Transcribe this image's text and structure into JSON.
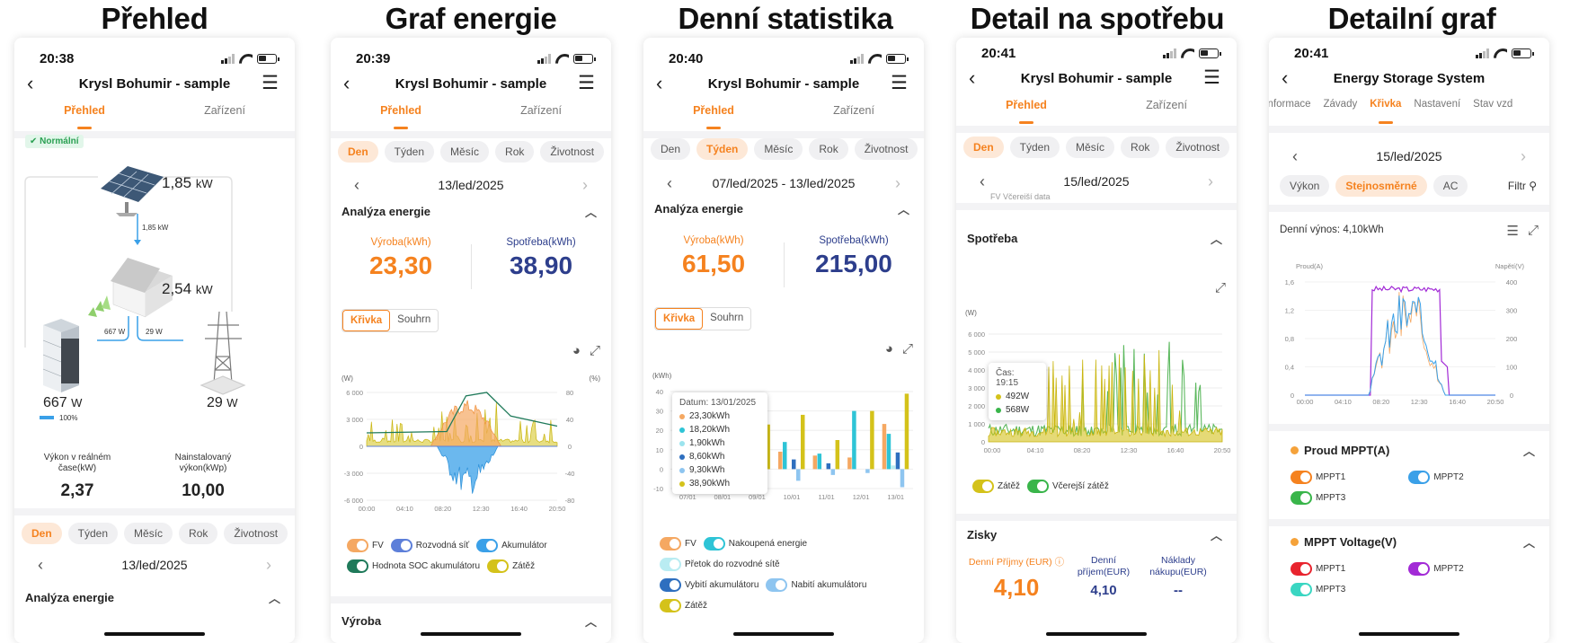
{
  "columns": [
    "Přehled",
    "Graf energie",
    "Denní statistika",
    "Detail na spotřebu",
    "Detailní graf"
  ],
  "colors": {
    "accent": "#f5821f",
    "navy": "#2d3e8c",
    "solar_blue": "#3aa0e8",
    "olive": "#d4c21a",
    "green": "#39b54a"
  },
  "p1": {
    "time": "20:38",
    "title": "Krysl Bohumir - sample",
    "tabs": [
      "Přehled",
      "Zařízení"
    ],
    "badge": "Normální",
    "pv_power": "1,85",
    "pv_unit": "kW",
    "pv_flow": "1,85 kW",
    "home_power": "2,54",
    "home_unit": "kW",
    "flow_left": "667 W",
    "flow_right": "29 W",
    "battery_power": "667",
    "battery_unit": "W",
    "battery_soc": "100%",
    "grid_power": "29",
    "grid_unit": "W",
    "realtime_label": "Výkon v reálném čase(kW)",
    "realtime_value": "2,37",
    "installed_label": "Nainstalovaný výkon(kWp)",
    "installed_value": "10,00",
    "periods": [
      "Den",
      "Týden",
      "Měsíc",
      "Rok",
      "Životnost"
    ],
    "date": "13/led/2025",
    "section": "Analýza energie"
  },
  "p2": {
    "time": "20:39",
    "title": "Krysl Bohumir - sample",
    "tabs": [
      "Přehled",
      "Zařízení"
    ],
    "periods": [
      "Den",
      "Týden",
      "Měsíc",
      "Rok",
      "Životnost"
    ],
    "date": "13/led/2025",
    "section": "Analýza energie",
    "prod_label": "Výroba(kWh)",
    "prod_value": "23,30",
    "cons_label": "Spotřeba(kWh)",
    "cons_value": "38,90",
    "seg": [
      "Křivka",
      "Souhrn"
    ],
    "y_left_unit": "(W)",
    "y_right_unit": "(%)",
    "legend": [
      "FV",
      "Rozvodná síť",
      "Akumulátor",
      "Hodnota SOC akumulátoru",
      "Zátěž"
    ],
    "section2": "Výroba"
  },
  "p3": {
    "time": "20:40",
    "title": "Krysl Bohumir - sample",
    "tabs": [
      "Přehled",
      "Zařízení"
    ],
    "periods": [
      "Den",
      "Týden",
      "Měsíc",
      "Rok",
      "Životnost"
    ],
    "date": "07/led/2025 - 13/led/2025",
    "section": "Analýza energie",
    "prod_label": "Výroba(kWh)",
    "prod_value": "61,50",
    "cons_label": "Spotřeba(kWh)",
    "cons_value": "215,00",
    "seg": [
      "Křivka",
      "Souhrn"
    ],
    "y_unit": "(kWh)",
    "tooltip_title": "Datum: 13/01/2025",
    "tooltip_rows": [
      "23,30kWh",
      "18,20kWh",
      "1,90kWh",
      "8,60kWh",
      "9,30kWh",
      "38,90kWh"
    ],
    "legend": [
      "FV",
      "Nakoupená energie",
      "Přetok do rozvodné sítě",
      "Vybití akumulátoru",
      "Nabití akumulátoru",
      "Zátěž"
    ]
  },
  "p4": {
    "time": "20:41",
    "title": "Krysl Bohumir - sample",
    "tabs": [
      "Přehled",
      "Zařízení"
    ],
    "periods": [
      "Den",
      "Týden",
      "Měsíc",
      "Rok",
      "Životnost"
    ],
    "date": "15/led/2025",
    "partial_legend": "FV   Včerejší data",
    "section": "Spotřeba",
    "y_unit": "(W)",
    "tooltip_title": "Čas: 19:15",
    "tooltip_rows": [
      "492W",
      "568W"
    ],
    "legend": [
      "Zátěž",
      "Včerejší zátěž"
    ],
    "section2": "Zisky",
    "daily_label": "Denní Příjmy (EUR)",
    "daily_value": "4,10",
    "income_label": "Denní příjem(EUR)",
    "income_value": "4,10",
    "cost_label": "Náklady nákupu(EUR)",
    "cost_value": "--"
  },
  "p5": {
    "time": "20:41",
    "title": "Energy Storage System",
    "tabs": [
      "informace",
      "Závady",
      "Křivka",
      "Nastavení",
      "Stav vzd"
    ],
    "date": "15/led/2025",
    "sub_tabs": [
      "Výkon",
      "Stejnosměrné",
      "AC"
    ],
    "filter": "Filtr",
    "daily_yield": "Denní výnos: 4,10kWh",
    "y_left_unit": "Proud(A)",
    "y_right_unit": "Napětí(V)",
    "group1": "Proud MPPT(A)",
    "group1_items": [
      "MPPT1",
      "MPPT2",
      "MPPT3"
    ],
    "group2": "MPPT Voltage(V)",
    "group2_items": [
      "MPPT1",
      "MPPT2",
      "MPPT3"
    ]
  },
  "chart_data": [
    {
      "type": "line",
      "title": "",
      "x": [
        "00:00",
        "04:10",
        "08:20",
        "12:30",
        "16:40",
        "20:50"
      ],
      "ylim": [
        -6000,
        6000
      ],
      "y2lim": [
        -80,
        80
      ],
      "series": [
        {
          "name": "FV",
          "values": [
            0,
            0,
            3200,
            5200,
            2500,
            0
          ]
        },
        {
          "name": "Rozvodná síť",
          "values": [
            0,
            0,
            0,
            0,
            0,
            0
          ]
        },
        {
          "name": "Akumulátor",
          "values": [
            0,
            0,
            -2000,
            -5500,
            1200,
            0
          ]
        },
        {
          "name": "Hodnota SOC akumulátoru",
          "values": [
            20,
            20,
            30,
            80,
            40,
            25
          ]
        },
        {
          "name": "Zátěž",
          "values": [
            2000,
            1800,
            2600,
            3000,
            3500,
            2400
          ]
        }
      ]
    },
    {
      "type": "bar",
      "categories": [
        "07/01",
        "08/01",
        "09/01",
        "10/01",
        "11/01",
        "12/01",
        "13/01"
      ],
      "ylim": [
        -10,
        40
      ],
      "series": [
        {
          "name": "FV",
          "values": [
            5,
            2,
            3,
            9,
            7,
            6,
            23.3
          ]
        },
        {
          "name": "Nakoupená energie",
          "values": [
            17,
            22,
            20,
            14,
            8,
            30,
            18.2
          ]
        },
        {
          "name": "Přetok do rozvodné sítě",
          "values": [
            0,
            0,
            0,
            0,
            0,
            0,
            1.9
          ]
        },
        {
          "name": "Vybití akumulátoru",
          "values": [
            0,
            0,
            0,
            5,
            3,
            0,
            8.6
          ]
        },
        {
          "name": "Nabití akumulátoru",
          "values": [
            -5,
            -3,
            -4,
            -6,
            -3,
            -2,
            -9.3
          ]
        },
        {
          "name": "Zátěž",
          "values": [
            22,
            24,
            23,
            28,
            15,
            30,
            38.9
          ]
        }
      ]
    },
    {
      "type": "line",
      "x": [
        "00:00",
        "04:10",
        "08:20",
        "12:30",
        "16:40",
        "20:50"
      ],
      "ylim": [
        0,
        6000
      ],
      "series": [
        {
          "name": "Zátěž",
          "values": [
            600,
            500,
            2200,
            5500,
            3800,
            1500
          ]
        },
        {
          "name": "Včerejší zátěž",
          "values": [
            700,
            600,
            1200,
            4800,
            5200,
            2600
          ]
        }
      ]
    },
    {
      "type": "line",
      "x": [
        "00:00",
        "04:10",
        "08:20",
        "12:30",
        "16:40",
        "20:50"
      ],
      "ylim": [
        0,
        1.6
      ],
      "y2lim": [
        0,
        400
      ],
      "series": [
        {
          "name": "MPPT1",
          "values": [
            0,
            0,
            0.5,
            1.5,
            0.6,
            0
          ]
        },
        {
          "name": "MPPT2",
          "values": [
            0,
            0,
            380,
            370,
            120,
            0
          ]
        }
      ]
    }
  ]
}
